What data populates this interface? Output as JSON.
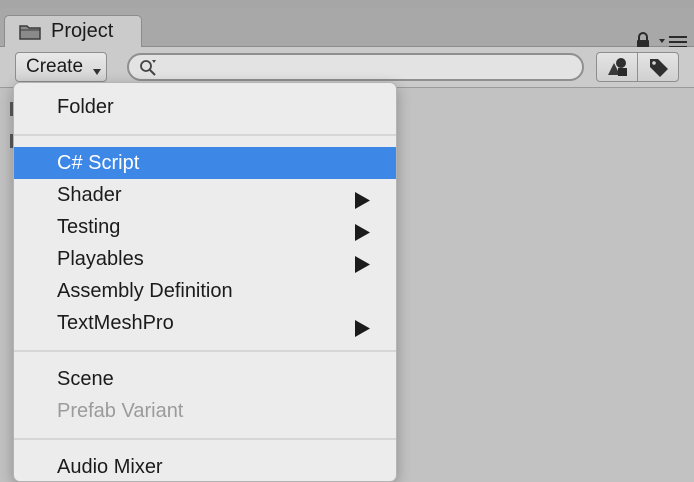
{
  "tab": {
    "title": "Project"
  },
  "toolbar": {
    "create_label": "Create",
    "search_placeholder": ""
  },
  "menu": {
    "items": [
      {
        "label": "Folder",
        "has_submenu": false,
        "state": "normal"
      },
      {
        "label": "C# Script",
        "has_submenu": false,
        "state": "selected"
      },
      {
        "label": "Shader",
        "has_submenu": true,
        "state": "normal"
      },
      {
        "label": "Testing",
        "has_submenu": true,
        "state": "normal"
      },
      {
        "label": "Playables",
        "has_submenu": true,
        "state": "normal"
      },
      {
        "label": "Assembly Definition",
        "has_submenu": false,
        "state": "normal"
      },
      {
        "label": "TextMeshPro",
        "has_submenu": true,
        "state": "normal"
      },
      {
        "label": "Scene",
        "has_submenu": false,
        "state": "normal"
      },
      {
        "label": "Prefab Variant",
        "has_submenu": false,
        "state": "disabled"
      },
      {
        "label": "Audio Mixer",
        "has_submenu": false,
        "state": "normal"
      }
    ]
  },
  "colors": {
    "selection": "#3d88e6",
    "menu_background": "#ececec",
    "disabled_text": "#9b9b9b",
    "panel_background": "#c2c2c2"
  },
  "icons": {
    "tab": "folder-icon",
    "lock": "lock-icon",
    "panel_menu": "panel-menu-icon",
    "search": "search-icon",
    "filter_type": "filter-by-type-icon",
    "filter_label": "filter-by-label-icon",
    "submenu": "submenu-arrow-icon"
  }
}
